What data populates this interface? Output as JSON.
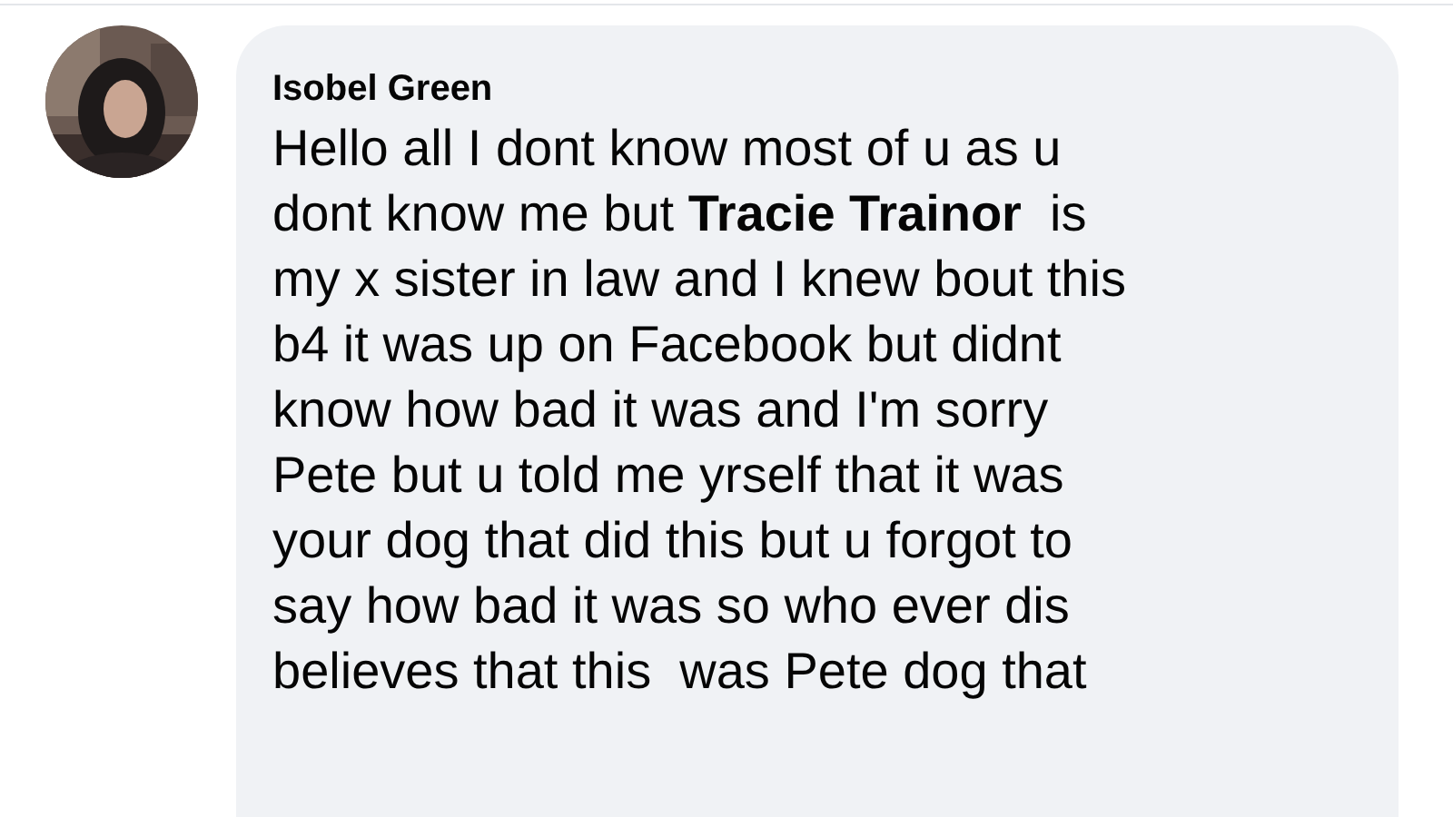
{
  "comment": {
    "author": "Isobel Green",
    "lines": [
      "Hello all I dont know most of u as u",
      "dont know me but **Tracie Trainor**  is",
      "my x sister in law and I knew bout this",
      "b4 it was up on Facebook but didnt",
      "know how bad it was and I'm sorry",
      "Pete but u told me yrself that it was",
      "your dog that did this but u forgot to",
      "say how bad it was so who ever dis",
      "believes that this  was Pete dog that"
    ]
  }
}
